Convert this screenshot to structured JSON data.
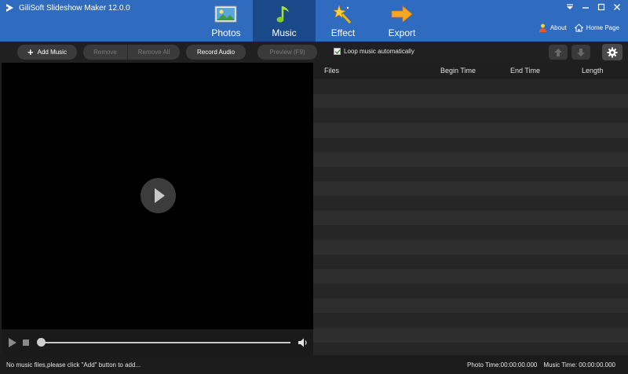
{
  "app": {
    "title": "GiliSoft Slideshow Maker 12.0.0"
  },
  "tabs": [
    {
      "label": "Photos",
      "icon": "photo-icon",
      "active": false
    },
    {
      "label": "Music",
      "icon": "music-note-icon",
      "active": true
    },
    {
      "label": "Effect",
      "icon": "magic-wand-icon",
      "active": false
    },
    {
      "label": "Export",
      "icon": "arrow-right-icon",
      "active": false
    }
  ],
  "top_links": {
    "about": "About",
    "home_page": "Home Page"
  },
  "toolbar": {
    "add_music": "Add Music",
    "remove": "Remove",
    "remove_all": "Remove All",
    "record_audio": "Record Audio",
    "preview": "Preview (F9)",
    "loop_label": "Loop music automatically",
    "loop_checked": true
  },
  "list": {
    "columns": [
      "Files",
      "Begin Time",
      "End Time",
      "Length"
    ],
    "rows": []
  },
  "status": {
    "message": "No music files,please click \"Add\" button to add...",
    "photo_time": "Photo Time:00:00:00.000",
    "music_time": "Music Time:  00:00:00.000"
  },
  "colors": {
    "title_bar": "#2f6bbf",
    "active_tab": "#1a4a8a",
    "background": "#1e1e1e"
  }
}
